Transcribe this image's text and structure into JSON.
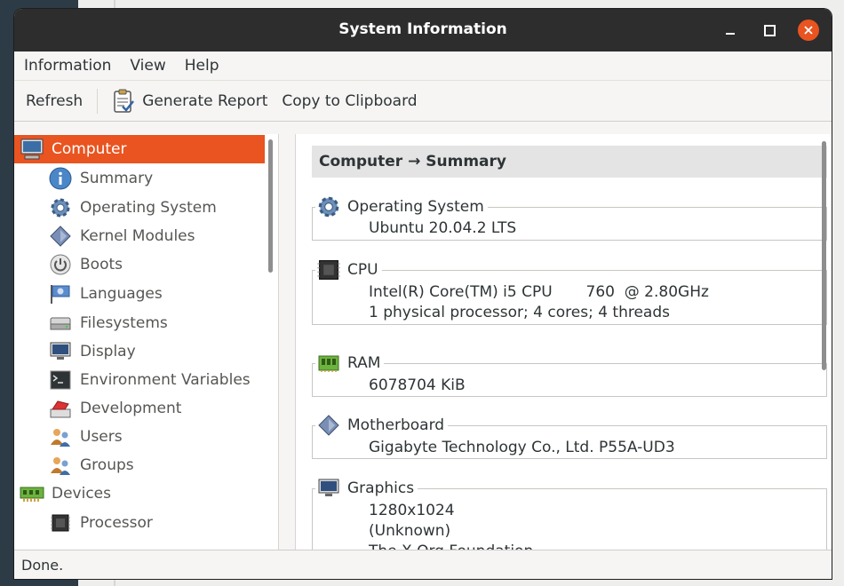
{
  "window": {
    "title": "System Information"
  },
  "menu": {
    "items": [
      "Information",
      "View",
      "Help"
    ]
  },
  "toolbar": {
    "refresh": "Refresh",
    "generate_report": "Generate Report",
    "copy_clipboard": "Copy to Clipboard"
  },
  "sidebar": {
    "computer": "Computer",
    "items": [
      {
        "label": "Summary",
        "icon": "info-icon"
      },
      {
        "label": "Operating System",
        "icon": "gear-icon"
      },
      {
        "label": "Kernel Modules",
        "icon": "module-icon"
      },
      {
        "label": "Boots",
        "icon": "power-icon"
      },
      {
        "label": "Languages",
        "icon": "flag-icon"
      },
      {
        "label": "Filesystems",
        "icon": "drive-icon"
      },
      {
        "label": "Display",
        "icon": "monitor-icon"
      },
      {
        "label": "Environment Variables",
        "icon": "terminal-icon"
      },
      {
        "label": "Development",
        "icon": "development-icon"
      },
      {
        "label": "Users",
        "icon": "users-icon"
      },
      {
        "label": "Groups",
        "icon": "groups-icon"
      }
    ],
    "devices": "Devices",
    "device_items": [
      {
        "label": "Processor",
        "icon": "chip-icon"
      }
    ]
  },
  "content": {
    "header": "Computer → Summary",
    "groups": [
      {
        "title": "Operating System",
        "lines": [
          "Ubuntu 20.04.2 LTS"
        ]
      },
      {
        "title": "CPU",
        "lines": [
          "Intel(R) Core(TM) i5 CPU       760  @ 2.80GHz",
          "1 physical processor; 4 cores; 4 threads"
        ]
      },
      {
        "title": "RAM",
        "lines": [
          "6078704 KiB"
        ]
      },
      {
        "title": "Motherboard",
        "lines": [
          "Gigabyte Technology Co., Ltd. P55A-UD3"
        ]
      },
      {
        "title": "Graphics",
        "lines": [
          "1280x1024",
          "(Unknown)",
          "The X.Org Foundation"
        ]
      }
    ]
  },
  "status": {
    "text": "Done."
  },
  "colors": {
    "accent": "#e95420",
    "titlebar": "#2d2d2d"
  }
}
